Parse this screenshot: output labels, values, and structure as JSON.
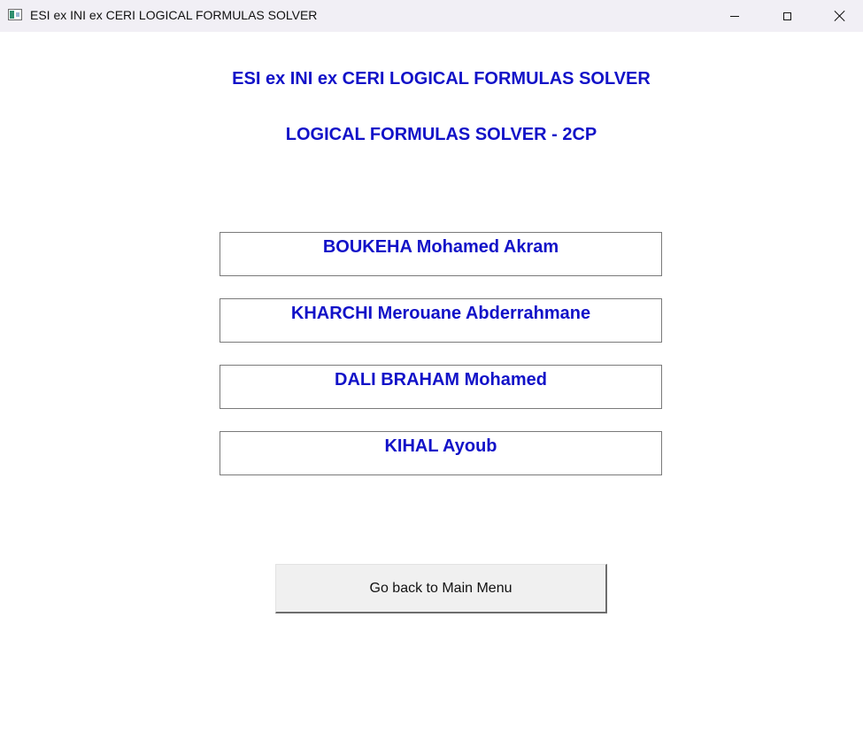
{
  "window": {
    "title": "ESI ex INI ex CERI LOGICAL FORMULAS SOLVER",
    "controls": {
      "minimize": "minimize-icon",
      "maximize": "maximize-icon",
      "close": "close-icon"
    }
  },
  "main": {
    "heading": "ESI ex INI ex CERI LOGICAL FORMULAS SOLVER",
    "subheading": "LOGICAL FORMULAS SOLVER - 2CP",
    "authors": [
      "BOUKEHA Mohamed Akram",
      "KHARCHI Merouane Abderrahmane",
      "DALI BRAHAM Mohamed",
      "KIHAL Ayoub"
    ],
    "back_button_label": "Go back to Main Menu"
  },
  "colors": {
    "heading_text": "#1212c8",
    "titlebar_bg": "#f1eff5",
    "button_bg": "#f0f0f0"
  }
}
